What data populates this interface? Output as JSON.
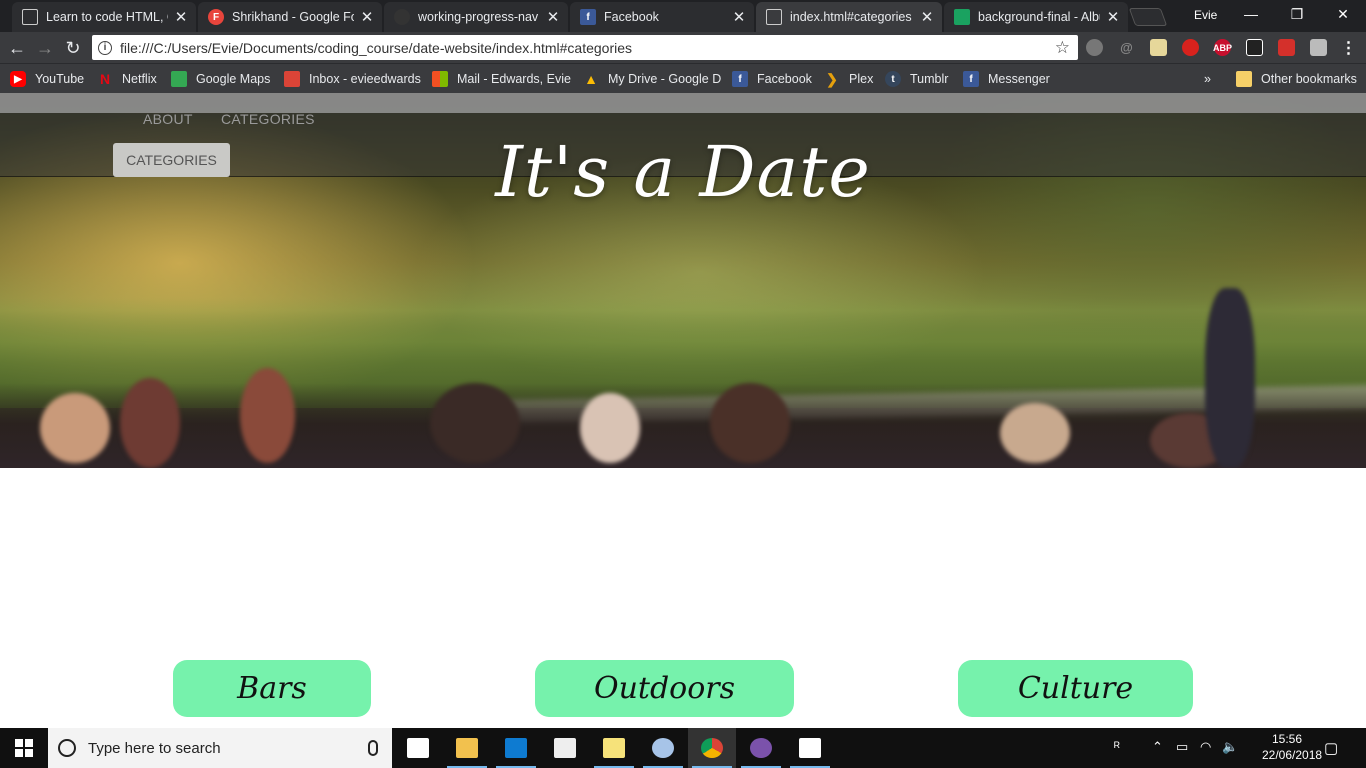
{
  "browser": {
    "tabs": [
      {
        "title": "Learn to code HTML, CSS",
        "favicon_color": "#ffffff"
      },
      {
        "title": "Shrikhand - Google Fonts",
        "favicon_color": "#e8453c"
      },
      {
        "title": "working-progress-nav",
        "favicon_color": "#333333"
      },
      {
        "title": "Facebook",
        "favicon_color": "#3b5998"
      },
      {
        "title": "index.html#categories",
        "favicon_color": "#ffffff"
      },
      {
        "title": "background-final - Album",
        "favicon_color": "#1aa260"
      }
    ],
    "profile_name": "Evie",
    "url": "file:///C:/Users/Evie/Documents/coding_course/date-website/index.html#categories",
    "bookmarks": [
      {
        "label": "YouTube",
        "icon": "youtube-icon",
        "color": "#ff0000"
      },
      {
        "label": "Netflix",
        "icon": "netflix-icon",
        "color": "#e50914"
      },
      {
        "label": "Google Maps",
        "icon": "maps-icon",
        "color": "#34a853"
      },
      {
        "label": "Inbox - evieedwards",
        "icon": "inbox-icon",
        "color": "#db4437"
      },
      {
        "label": "Mail - Edwards, Evie",
        "icon": "mail-icon",
        "color": "#f25022"
      },
      {
        "label": "My Drive - Google D",
        "icon": "drive-icon",
        "color": "#fbbc05"
      },
      {
        "label": "Facebook",
        "icon": "facebook-icon",
        "color": "#3b5998"
      },
      {
        "label": "Plex",
        "icon": "plex-icon",
        "color": "#e5a00d"
      },
      {
        "label": "Tumblr",
        "icon": "tumblr-icon",
        "color": "#35465c"
      },
      {
        "label": "Messenger",
        "icon": "facebook-icon",
        "color": "#3b5998"
      }
    ],
    "other_bookmarks": "Other bookmarks",
    "overflow": "»"
  },
  "site": {
    "nav": [
      "ABOUT",
      "CATEGORIES"
    ],
    "active_nav": "CATEGORIES",
    "title": "It's a Date",
    "categories": [
      "Bars",
      "Outdoors",
      "Culture"
    ],
    "accent_color": "#76f2ac"
  },
  "taskbar": {
    "search_placeholder": "Type here to search",
    "time": "15:56",
    "date": "22/06/2018"
  }
}
